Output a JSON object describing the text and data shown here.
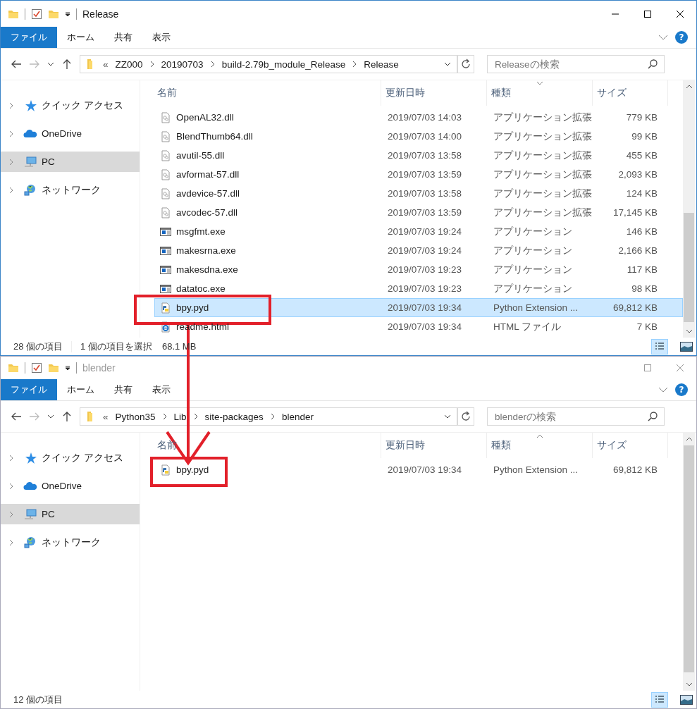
{
  "windows": [
    {
      "title": "Release",
      "active": true,
      "ribbon": {
        "tabs": [
          {
            "label": "ファイル",
            "selected": true
          },
          {
            "label": "ホーム",
            "selected": false
          },
          {
            "label": "共有",
            "selected": false
          },
          {
            "label": "表示",
            "selected": false
          }
        ],
        "help": "?"
      },
      "address": {
        "overflow": "«",
        "crumbs": [
          "ZZ000",
          "20190703",
          "build-2.79b_module_Release",
          "Release"
        ]
      },
      "search": {
        "placeholder": "Releaseの検索"
      },
      "navigation": [
        {
          "kind": "quick-access",
          "label": "クイック アクセス",
          "selected": false
        },
        {
          "kind": "cloud",
          "label": "OneDrive",
          "selected": false
        },
        {
          "kind": "pc",
          "label": "PC",
          "selected": true
        },
        {
          "kind": "network",
          "label": "ネットワーク",
          "selected": false
        }
      ],
      "columns": [
        {
          "label": "名前",
          "sorted": false
        },
        {
          "label": "更新日時",
          "sorted": false
        },
        {
          "label": "種類",
          "sorted": true
        },
        {
          "label": "サイズ",
          "sorted": false
        }
      ],
      "sort_descending": true,
      "files": [
        {
          "kind": "dll",
          "name": "OpenAL32.dll",
          "modified": "2019/07/03 14:03",
          "type": "アプリケーション拡張",
          "size": "779 KB",
          "selected": false
        },
        {
          "kind": "dll",
          "name": "BlendThumb64.dll",
          "modified": "2019/07/03 14:00",
          "type": "アプリケーション拡張",
          "size": "99 KB",
          "selected": false
        },
        {
          "kind": "dll",
          "name": "avutil-55.dll",
          "modified": "2019/07/03 13:58",
          "type": "アプリケーション拡張",
          "size": "455 KB",
          "selected": false
        },
        {
          "kind": "dll",
          "name": "avformat-57.dll",
          "modified": "2019/07/03 13:59",
          "type": "アプリケーション拡張",
          "size": "2,093 KB",
          "selected": false
        },
        {
          "kind": "dll",
          "name": "avdevice-57.dll",
          "modified": "2019/07/03 13:58",
          "type": "アプリケーション拡張",
          "size": "124 KB",
          "selected": false
        },
        {
          "kind": "dll",
          "name": "avcodec-57.dll",
          "modified": "2019/07/03 13:59",
          "type": "アプリケーション拡張",
          "size": "17,145 KB",
          "selected": false
        },
        {
          "kind": "exe",
          "name": "msgfmt.exe",
          "modified": "2019/07/03 19:24",
          "type": "アプリケーション",
          "size": "146 KB",
          "selected": false
        },
        {
          "kind": "exe",
          "name": "makesrna.exe",
          "modified": "2019/07/03 19:24",
          "type": "アプリケーション",
          "size": "2,166 KB",
          "selected": false
        },
        {
          "kind": "exe",
          "name": "makesdna.exe",
          "modified": "2019/07/03 19:23",
          "type": "アプリケーション",
          "size": "117 KB",
          "selected": false
        },
        {
          "kind": "exe",
          "name": "datatoc.exe",
          "modified": "2019/07/03 19:23",
          "type": "アプリケーション",
          "size": "98 KB",
          "selected": false
        },
        {
          "kind": "pyd",
          "name": "bpy.pyd",
          "modified": "2019/07/03 19:34",
          "type": "Python Extension ...",
          "size": "69,812 KB",
          "selected": true
        },
        {
          "kind": "html",
          "name": "readme.html",
          "modified": "2019/07/03 19:34",
          "type": "HTML ファイル",
          "size": "7 KB",
          "selected": false
        }
      ],
      "status": {
        "count": "28 個の項目",
        "selection": "1 個の項目を選択",
        "selection_size": "68.1 MB"
      },
      "views": [
        {
          "kind": "details",
          "selected": true
        },
        {
          "kind": "tiles",
          "selected": false
        }
      ]
    },
    {
      "title": "blender",
      "active": false,
      "ribbon": {
        "tabs": [
          {
            "label": "ファイル",
            "selected": true
          },
          {
            "label": "ホーム",
            "selected": false
          },
          {
            "label": "共有",
            "selected": false
          },
          {
            "label": "表示",
            "selected": false
          }
        ],
        "help": "?"
      },
      "address": {
        "overflow": "«",
        "crumbs": [
          "Python35",
          "Lib",
          "site-packages",
          "blender"
        ]
      },
      "search": {
        "placeholder": "blenderの検索"
      },
      "navigation": [
        {
          "kind": "quick-access",
          "label": "クイック アクセス",
          "selected": false
        },
        {
          "kind": "cloud",
          "label": "OneDrive",
          "selected": false
        },
        {
          "kind": "pc",
          "label": "PC",
          "selected": true
        },
        {
          "kind": "network",
          "label": "ネットワーク",
          "selected": false
        }
      ],
      "columns": [
        {
          "label": "名前",
          "sorted": false
        },
        {
          "label": "更新日時",
          "sorted": false
        },
        {
          "label": "種類",
          "sorted": true
        },
        {
          "label": "サイズ",
          "sorted": false
        }
      ],
      "sort_descending": false,
      "files": [
        {
          "kind": "pyd",
          "name": "bpy.pyd",
          "modified": "2019/07/03 19:34",
          "type": "Python Extension ...",
          "size": "69,812 KB",
          "selected": false
        }
      ],
      "status": {
        "count": "12 個の項目"
      },
      "views": [
        {
          "kind": "details",
          "selected": true
        },
        {
          "kind": "tiles",
          "selected": false
        }
      ]
    }
  ]
}
